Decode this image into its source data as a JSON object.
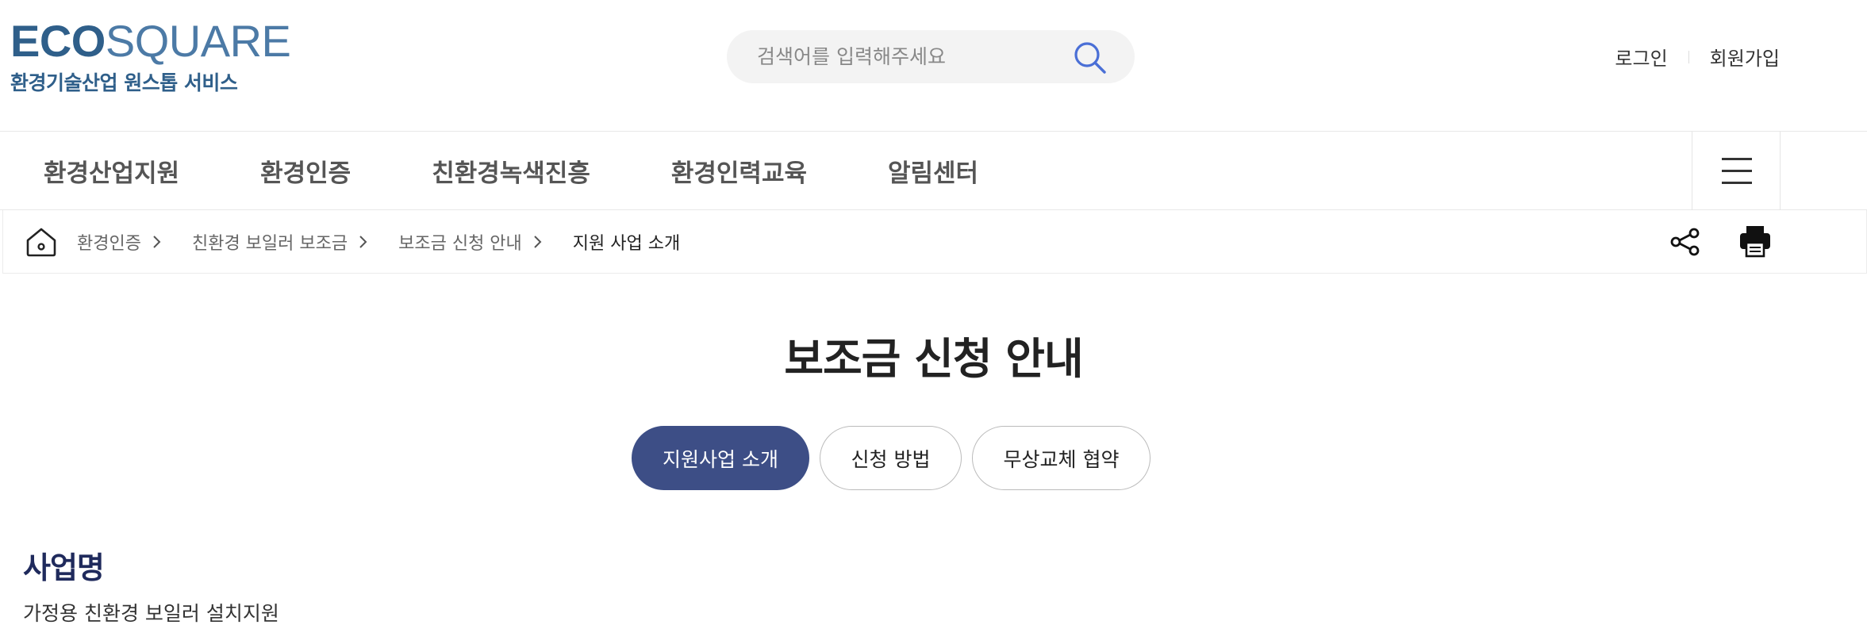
{
  "header": {
    "logo": {
      "word_bold": "ECO",
      "word_light": "SQUARE",
      "subtitle": "환경기술산업 원스톱 서비스"
    },
    "search": {
      "placeholder": "검색어를 입력해주세요",
      "value": ""
    },
    "util": {
      "login": "로그인",
      "signup": "회원가입"
    }
  },
  "gnb": {
    "items": [
      "환경산업지원",
      "환경인증",
      "친환경녹색진흥",
      "환경인력교육",
      "알림센터"
    ]
  },
  "breadcrumb": {
    "items": [
      "환경인증",
      "친환경 보일러 보조금",
      "보조금 신청 안내"
    ],
    "current": "지원 사업 소개"
  },
  "main": {
    "title": "보조금 신청 안내",
    "tabs": [
      {
        "label": "지원사업 소개",
        "active": true
      },
      {
        "label": "신청 방법",
        "active": false
      },
      {
        "label": "무상교체 협약",
        "active": false
      }
    ],
    "section": {
      "title": "사업명",
      "body": "가정용 친환경 보일러 설치지원"
    }
  },
  "icons": {
    "search": "search-icon",
    "menu": "hamburger-menu-icon",
    "home": "home-icon",
    "crumb_separator": "chevron-right-icon",
    "share": "share-icon",
    "print": "printer-icon"
  },
  "colors": {
    "brand": "#2f5f8a",
    "tab_active": "#3d4e86",
    "section_title": "#1f2a5c",
    "search_icon": "#4a6fd6"
  }
}
